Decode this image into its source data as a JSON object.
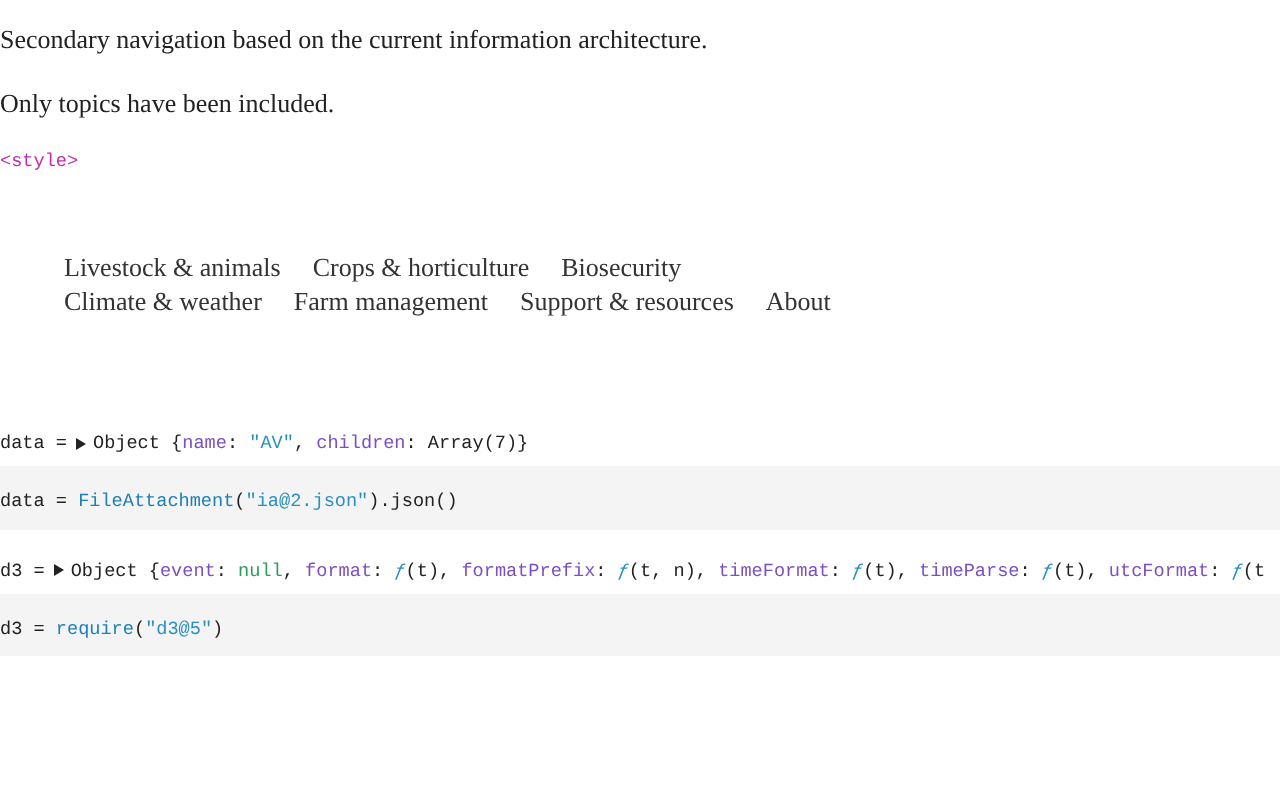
{
  "paragraphs": [
    "Secondary navigation based on the current information architecture.",
    "Only topics have been included."
  ],
  "style_cell": "<style>",
  "nav_rows": [
    [
      "Livestock & animals",
      "Crops & horticulture",
      "Biosecurity"
    ],
    [
      "Climate & weather",
      "Farm management",
      "Support & resources",
      "About"
    ]
  ],
  "cells": [
    {
      "output": {
        "prefix": "data =",
        "expandable": true,
        "tokens": [
          {
            "kind": "plain",
            "text": "Object {"
          },
          {
            "kind": "prop",
            "text": "name"
          },
          {
            "kind": "plain",
            "text": ": "
          },
          {
            "kind": "string",
            "text": "\"AV\""
          },
          {
            "kind": "plain",
            "text": ", "
          },
          {
            "kind": "prop",
            "text": "children"
          },
          {
            "kind": "plain",
            "text": ": Array(7)}"
          }
        ]
      },
      "source": [
        {
          "kind": "plain",
          "text": "data = "
        },
        {
          "kind": "call",
          "text": "FileAttachment"
        },
        {
          "kind": "plain",
          "text": "("
        },
        {
          "kind": "string",
          "text": "\"ia@2.json\""
        },
        {
          "kind": "plain",
          "text": ").json()"
        }
      ]
    },
    {
      "output": {
        "prefix": "d3 =",
        "expandable": true,
        "tokens": [
          {
            "kind": "plain",
            "text": "Object {"
          },
          {
            "kind": "prop",
            "text": "event"
          },
          {
            "kind": "plain",
            "text": ": "
          },
          {
            "kind": "null",
            "text": "null"
          },
          {
            "kind": "plain",
            "text": ", "
          },
          {
            "kind": "prop",
            "text": "format"
          },
          {
            "kind": "plain",
            "text": ": "
          },
          {
            "kind": "func",
            "text": "ƒ"
          },
          {
            "kind": "plain",
            "text": "(t), "
          },
          {
            "kind": "prop",
            "text": "formatPrefix"
          },
          {
            "kind": "plain",
            "text": ": "
          },
          {
            "kind": "func",
            "text": "ƒ"
          },
          {
            "kind": "plain",
            "text": "(t, n), "
          },
          {
            "kind": "prop",
            "text": "timeFormat"
          },
          {
            "kind": "plain",
            "text": ": "
          },
          {
            "kind": "func",
            "text": "ƒ"
          },
          {
            "kind": "plain",
            "text": "(t), "
          },
          {
            "kind": "prop",
            "text": "timeParse"
          },
          {
            "kind": "plain",
            "text": ": "
          },
          {
            "kind": "func",
            "text": "ƒ"
          },
          {
            "kind": "plain",
            "text": "(t), "
          },
          {
            "kind": "prop",
            "text": "utcFormat"
          },
          {
            "kind": "plain",
            "text": ": "
          },
          {
            "kind": "func",
            "text": "ƒ"
          },
          {
            "kind": "plain",
            "text": "(t"
          }
        ]
      },
      "source": [
        {
          "kind": "plain",
          "text": "d3 = "
        },
        {
          "kind": "call",
          "text": "require"
        },
        {
          "kind": "plain",
          "text": "("
        },
        {
          "kind": "string",
          "text": "\"d3@5\""
        },
        {
          "kind": "plain",
          "text": ")"
        }
      ]
    }
  ]
}
